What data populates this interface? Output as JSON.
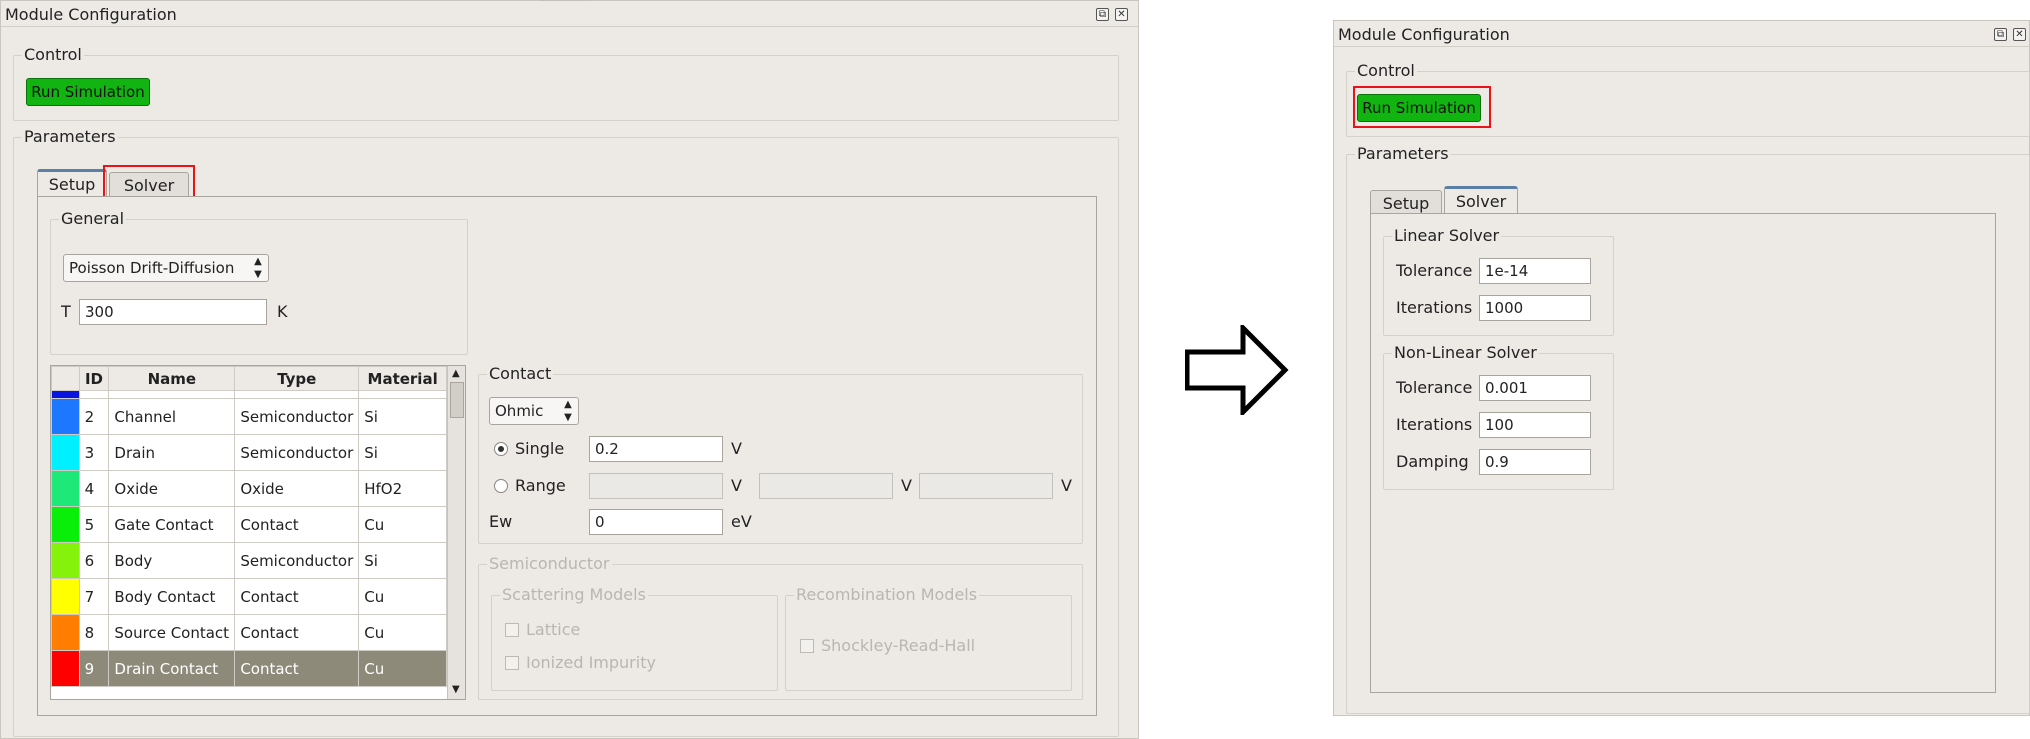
{
  "left_window": {
    "title": "Module Configuration",
    "control_group": "Control",
    "run_button": "Run Simulation",
    "parameters_group": "Parameters",
    "tabs": [
      "Setup",
      "Solver"
    ],
    "active_tab": "Setup",
    "general_group": "General",
    "model_select": "Poisson Drift-Diffusion",
    "temperature_label": "T",
    "temperature_value": "300",
    "temperature_unit": "K",
    "table": {
      "headers": [
        "ID",
        "Name",
        "Type",
        "Material"
      ],
      "rows": [
        {
          "id": "2",
          "name": "Channel",
          "type": "Semiconductor",
          "material": "Si",
          "color": "#1e78ff"
        },
        {
          "id": "3",
          "name": "Drain",
          "type": "Semiconductor",
          "material": "Si",
          "color": "#00f0ff"
        },
        {
          "id": "4",
          "name": "Oxide",
          "type": "Oxide",
          "material": "HfO2",
          "color": "#1ee878"
        },
        {
          "id": "5",
          "name": "Gate Contact",
          "type": "Contact",
          "material": "Cu",
          "color": "#0aef0a"
        },
        {
          "id": "6",
          "name": "Body",
          "type": "Semiconductor",
          "material": "Si",
          "color": "#84f20a"
        },
        {
          "id": "7",
          "name": "Body Contact",
          "type": "Contact",
          "material": "Cu",
          "color": "#ffff00"
        },
        {
          "id": "8",
          "name": "Source Contact",
          "type": "Contact",
          "material": "Cu",
          "color": "#ff7d00"
        },
        {
          "id": "9",
          "name": "Drain Contact",
          "type": "Contact",
          "material": "Cu",
          "color": "#ff0000"
        }
      ],
      "top_partial_color": "#0a14e0",
      "selected_id": "9"
    },
    "contact": {
      "group": "Contact",
      "type_select": "Ohmic",
      "single_label": "Single",
      "single_value": "0.2",
      "unit_v": "V",
      "range_label": "Range",
      "ew_label": "Ew",
      "ew_value": "0",
      "ew_unit": "eV"
    },
    "semiconductor": {
      "group": "Semiconductor",
      "scattering_group": "Scattering Models",
      "lattice": "Lattice",
      "ionized": "Ionized Impurity",
      "recombination_group": "Recombination Models",
      "srh": "Shockley-Read-Hall"
    }
  },
  "right_window": {
    "title": "Module Configuration",
    "control_group": "Control",
    "run_button": "Run Simulation",
    "parameters_group": "Parameters",
    "tabs": [
      "Setup",
      "Solver"
    ],
    "active_tab": "Solver",
    "linear": {
      "group": "Linear Solver",
      "tolerance_label": "Tolerance",
      "tolerance_value": "1e-14",
      "iterations_label": "Iterations",
      "iterations_value": "1000"
    },
    "nonlinear": {
      "group": "Non-Linear Solver",
      "tolerance_label": "Tolerance",
      "tolerance_value": "0.001",
      "iterations_label": "Iterations",
      "iterations_value": "100",
      "damping_label": "Damping",
      "damping_value": "0.9"
    }
  },
  "colors": {
    "highlight": "#e8141a",
    "run_button": "#11b411",
    "panel_bg": "#edeae6",
    "selected_row": "#8d8a7a"
  }
}
